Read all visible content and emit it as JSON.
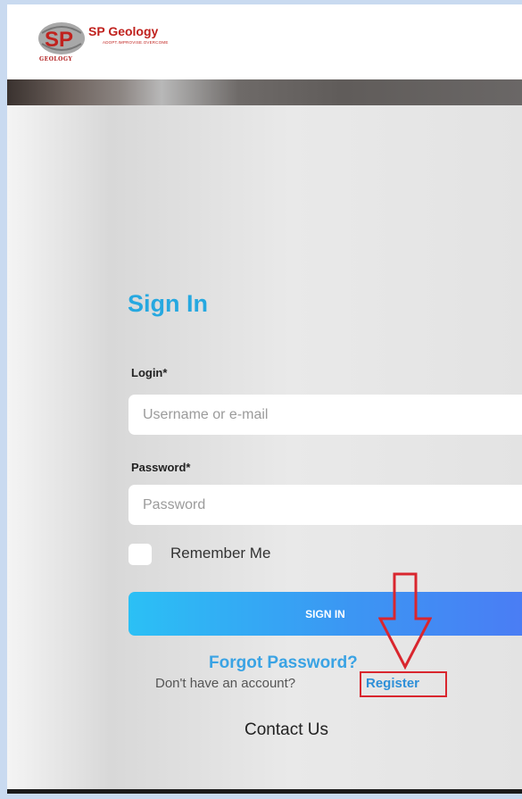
{
  "brand": {
    "name": "SP Geology",
    "tagline": "ADOPT.IMPROVISE.OVERCOME",
    "logo_letters": "SP",
    "logo_sub": "GEOLOGY",
    "brand_color": "#c0221e"
  },
  "signin": {
    "title": "Sign In",
    "login_label": "Login*",
    "login_placeholder": "Username or e-mail",
    "password_label": "Password*",
    "password_placeholder": "Password",
    "remember_label": "Remember Me",
    "button_label": "SIGN IN",
    "forgot_label": "Forgot Password?",
    "no_account_text": "Don't have an account?",
    "register_label": "Register",
    "contact_label": "Contact Us"
  },
  "colors": {
    "accent": "#26a8e0",
    "button_gradient_start": "#2bc0f5",
    "button_gradient_end": "#4a7df4",
    "annotation_red": "#d9262e"
  },
  "annotation": {
    "arrow_icon": "down-arrow-icon",
    "highlight": "register-highlight-box"
  }
}
